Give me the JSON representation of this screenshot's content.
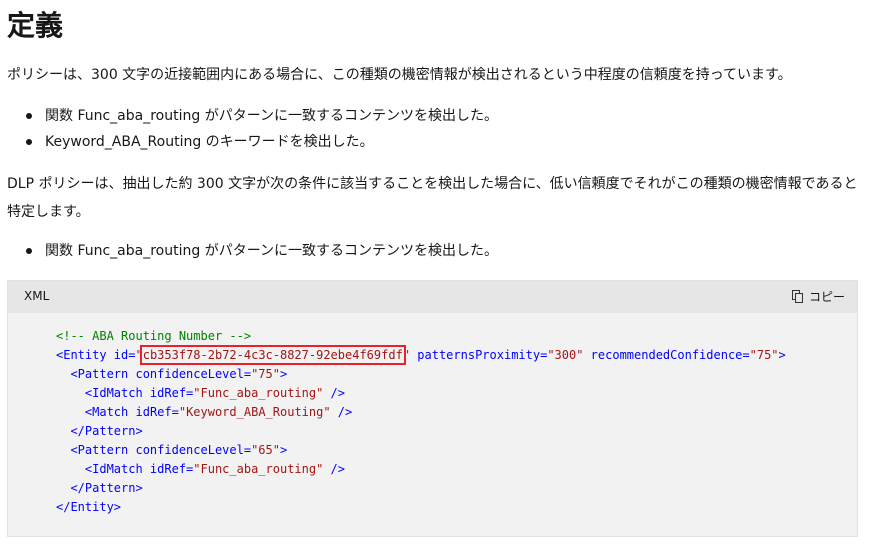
{
  "heading": "定義",
  "intro": "ポリシーは、300 文字の近接範囲内にある場合に、この種類の機密情報が検出されるという中程度の信頼度を持っています。",
  "list1": [
    "関数 Func_aba_routing がパターンに一致するコンテンツを検出した。",
    "Keyword_ABA_Routing のキーワードを検出した。"
  ],
  "para2": "DLP ポリシーは、抽出した約 300 文字が次の条件に該当することを検出した場合に、低い信頼度でそれがこの種類の機密情報であると特定します。",
  "list2": [
    "関数 Func_aba_routing がパターンに一致するコンテンツを検出した。"
  ],
  "code": {
    "language": "XML",
    "copy_label": "コピー",
    "copy_icon": "copy-icon",
    "highlight_color": "#e8212b",
    "comment": "<!-- ABA Routing Number -->",
    "entity_open": "<Entity",
    "entity_id_attr": " id=",
    "entity_id_value": "cb353f78-2b72-4c3c-8827-92ebe4f69fdf",
    "proximity_attr": " patternsProximity=",
    "proximity_value": "\"300\"",
    "rec_attr": " recommendedConfidence=",
    "rec_value": "\"75\"",
    "pattern_open": "<Pattern",
    "conf_attr": " confidenceLevel=",
    "conf1_value": "\"75\"",
    "conf2_value": "\"65\"",
    "idmatch_open": "<IdMatch",
    "match_open": "<Match",
    "idref_attr": " idRef=",
    "func_value": "\"Func_aba_routing\"",
    "kw_value": "\"Keyword_ABA_Routing\"",
    "self_close": " />",
    "tag_end": ">",
    "quote": "\"",
    "pattern_close": "</Pattern>",
    "entity_close": "</Entity>"
  }
}
